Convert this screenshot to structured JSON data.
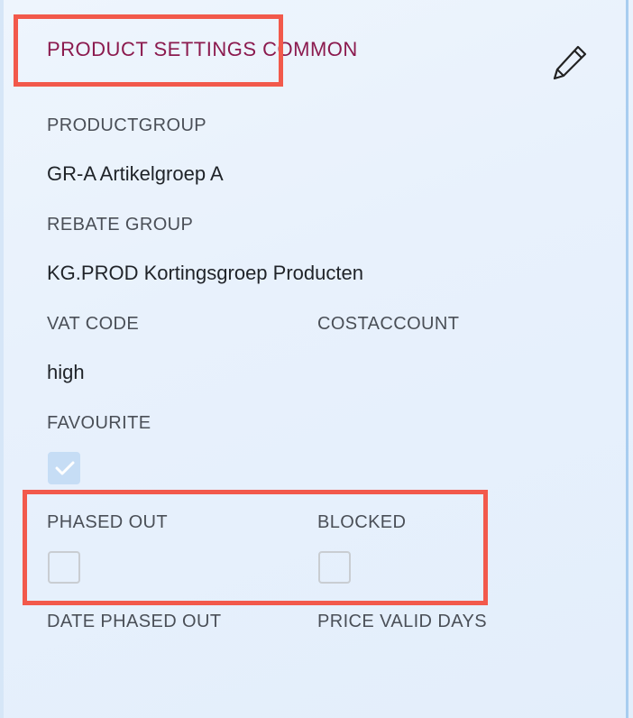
{
  "section": {
    "title": "PRODUCT SETTINGS COMMON"
  },
  "fields": {
    "productgroup": {
      "label": "PRODUCTGROUP",
      "value": "GR-A Artikelgroep A"
    },
    "rebate_group": {
      "label": "REBATE GROUP",
      "value": "KG.PROD Kortingsgroep Producten"
    },
    "vat_code": {
      "label": "VAT CODE",
      "value": "high"
    },
    "costaccount": {
      "label": "COSTACCOUNT",
      "value": ""
    },
    "favourite": {
      "label": "FAVOURITE",
      "checked": true
    },
    "phased_out": {
      "label": "PHASED OUT",
      "checked": false
    },
    "blocked": {
      "label": "BLOCKED",
      "checked": false
    },
    "date_phased_out": {
      "label": "DATE PHASED OUT"
    },
    "price_valid_days": {
      "label": "PRICE VALID DAYS"
    }
  },
  "icons": {
    "edit": "pencil-icon",
    "check": "checkmark-icon"
  },
  "colors": {
    "title": "#8b1a4e",
    "highlight": "#f2594b",
    "checked_bg": "#c6ddf5"
  }
}
